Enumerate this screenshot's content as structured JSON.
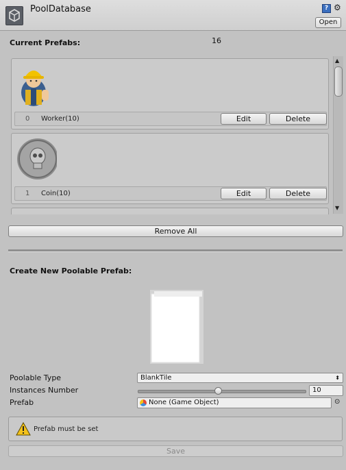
{
  "header": {
    "title": "PoolDatabase",
    "open_label": "Open",
    "help_icon": "help-icon",
    "settings_icon": "gear-icon"
  },
  "current": {
    "label": "Current Prefabs:",
    "count": "16"
  },
  "prefabs": [
    {
      "index": "0",
      "name": "Worker(10)",
      "icon": "worker-icon"
    },
    {
      "index": "1",
      "name": "Coin(10)",
      "icon": "coin-icon"
    }
  ],
  "buttons": {
    "edit": "Edit",
    "delete": "Delete",
    "remove_all": "Remove All",
    "save": "Save"
  },
  "create": {
    "label": "Create New Poolable Prefab:",
    "type_label": "Poolable Type",
    "type_value": "BlankTile",
    "instances_label": "Instances Number",
    "instances_value": "10",
    "instances_slider_fraction": 0.47,
    "prefab_label": "Prefab",
    "prefab_value": "None (Game Object)"
  },
  "warning": "Prefab must be set",
  "colors": {
    "panel": "#c2c2c2",
    "warning": "#f3c21a"
  }
}
